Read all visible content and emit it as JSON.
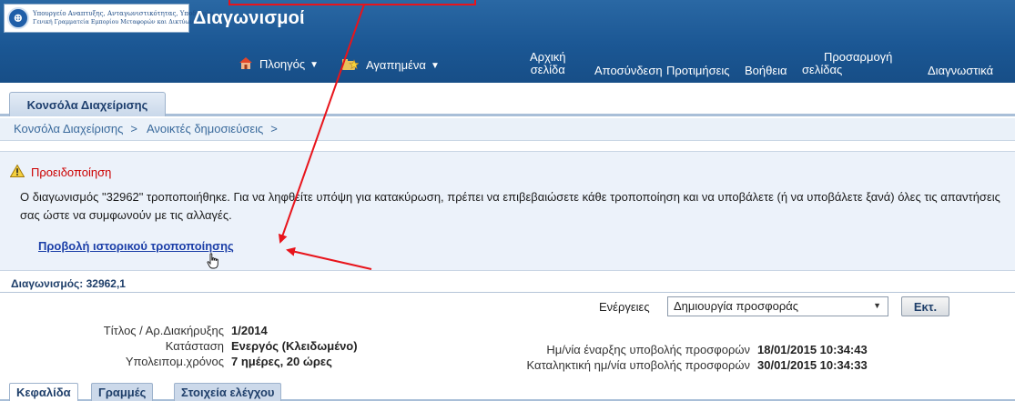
{
  "header": {
    "logo_line1": "Υπουργείο Αναπτυξης, Ανταγωνιστικότητας, Υποδομών,",
    "logo_line2": "Γενική Γραμματεία Εμπορίου    Μεταφορών και Δικτύων",
    "app_title": "Διαγωνισμοί",
    "nav": {
      "navigator": "Πλοηγός",
      "favorites": "Αγαπημένα",
      "home_line1": "Αρχική",
      "home_line2": "σελίδα",
      "logout": "Αποσύνδεση",
      "preferences": "Προτιμήσεις",
      "help": "Βοήθεια",
      "customize_line1": "Προσαρμογή",
      "customize_line2": "σελίδας",
      "diagnostics": "Διαγνωστικά"
    }
  },
  "tabs": {
    "console": "Κονσόλα Διαχείρισης"
  },
  "breadcrumb": {
    "items": [
      "Κονσόλα Διαχείρισης",
      "Ανοικτές δημοσιεύσεις"
    ],
    "separator": ">"
  },
  "warning": {
    "title": "Προειδοποίηση",
    "message": "Ο διαγωνισμός \"32962\" τροποποιήθηκε. Για να ληφθείτε υπόψη για κατακύρωση, πρέπει να επιβεβαιώσετε κάθε τροποποίηση και να υποβάλετε (ή να υποβάλετε ξανά) όλες τις απαντήσεις σας ώστε να συμφωνούν με τις αλλαγές.",
    "link": "Προβολή ιστορικού τροποποίησης"
  },
  "tender": {
    "title": "Διαγωνισμός: 32962,1",
    "actions_label": "Ενέργειες",
    "actions_selected": "Δημιουργία προσφοράς",
    "go_button": "Εκτ.",
    "fields_left": [
      {
        "label": "Τίτλος / Αρ.Διακήρυξης",
        "value": "1/2014"
      },
      {
        "label": "Κατάσταση",
        "value": "Ενεργός (Κλειδωμένο)"
      },
      {
        "label": "Υπολειπομ.χρόνος",
        "value": "7 ημέρες, 20 ώρες"
      }
    ],
    "fields_right": [
      {
        "label": "Ημ/νία έναρξης υποβολής προσφορών",
        "value": "18/01/2015 10:34:43"
      },
      {
        "label": "Καταληκτική ημ/νία υποβολής προσφορών",
        "value": "30/01/2015 10:34:33"
      }
    ]
  },
  "bottom_tabs": [
    "Κεφαλίδα",
    "Γραμμές",
    "Στοιχεία ελέγχου"
  ],
  "colors": {
    "header_blue": "#1b5794",
    "annotation_red": "#e8141b",
    "link_blue": "#1c3fa8",
    "warning_red": "#cc0000"
  }
}
